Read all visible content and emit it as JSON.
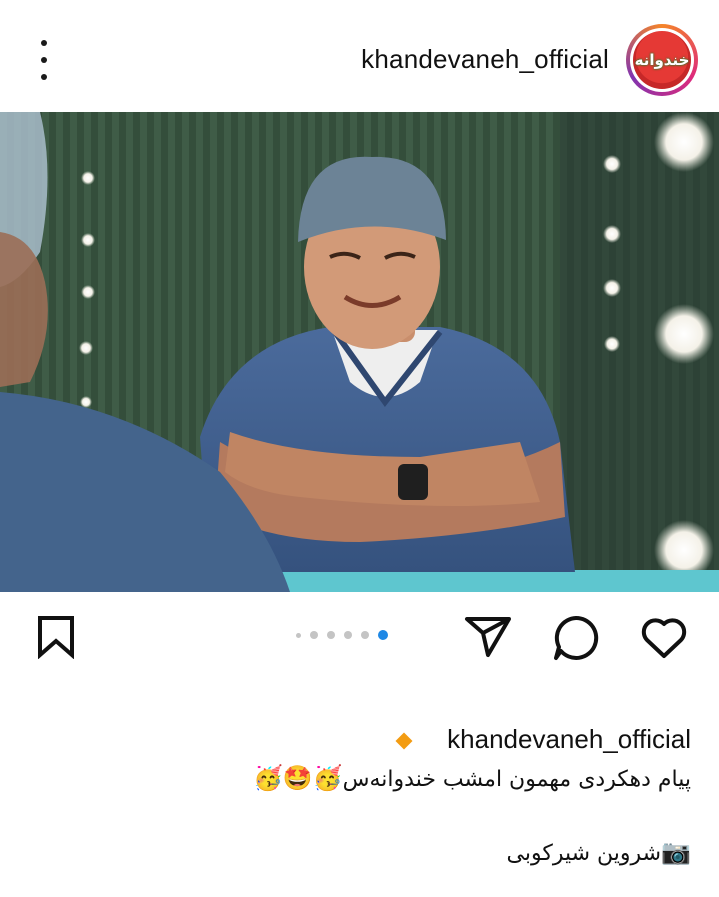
{
  "header": {
    "username": "khandevaneh_official",
    "avatar_text": "خندوانه",
    "more_icon": "more-vertical-icon"
  },
  "post": {
    "carousel": {
      "count": 6,
      "active_index": 5
    }
  },
  "actions": {
    "save_icon": "bookmark-icon",
    "share_icon": "send-icon",
    "comment_icon": "comment-icon",
    "like_icon": "heart-icon"
  },
  "caption": {
    "username": "khandevaneh_official",
    "line1_text": "پیام دهکردی مهمون امشب خندوانه‌س",
    "line1_emojis": "🥳🤩🥳",
    "line2_emoji": "📷",
    "line2_text": "شروین شیرکوبی"
  },
  "colors": {
    "accent": "#1e88e5",
    "verified_diamond": "#f39c12"
  }
}
